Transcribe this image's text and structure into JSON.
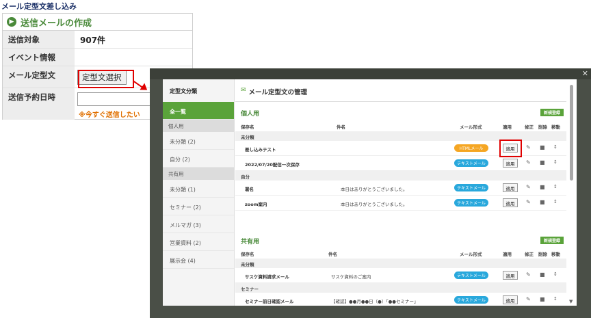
{
  "page_title": "メール定型文差し込み",
  "form": {
    "heading": "送信メールの作成",
    "rows": [
      {
        "label": "送信対象",
        "value": "907件"
      },
      {
        "label": "イベント情報",
        "value": ""
      },
      {
        "label": "メール定型文",
        "button": "定型文選択"
      },
      {
        "label": "送信予約日時",
        "note": "※今すぐ送信したい"
      }
    ]
  },
  "modal": {
    "sidebar_title": "定型文分類",
    "sidebar_items": [
      {
        "label": "全一覧",
        "active": true
      },
      {
        "group": "個人用"
      },
      {
        "label": "未分類 (2)"
      },
      {
        "label": "自分 (2)"
      },
      {
        "group": "共有用"
      },
      {
        "label": "未分類 (1)"
      },
      {
        "label": "セミナー (2)"
      },
      {
        "label": "メルマガ (3)"
      },
      {
        "label": "営業資料 (2)"
      },
      {
        "label": "展示会 (4)"
      }
    ],
    "title": "メール定型文の管理",
    "columns": {
      "name": "保存名",
      "subject": "件名",
      "format": "メール形式",
      "apply": "適用",
      "edit": "修正",
      "delete": "削除",
      "move": "移動"
    },
    "new_button": "新規登録",
    "sections": [
      {
        "title": "個人用",
        "groups": [
          {
            "name": "未分類",
            "rows": [
              {
                "name": "差し込みテスト",
                "subject": "",
                "format": "HTMLメール",
                "apply": "適用"
              },
              {
                "name": "2022/07/20配信一次保存",
                "subject": "",
                "format": "テキストメール",
                "apply": "適用"
              }
            ]
          },
          {
            "name": "自分",
            "rows": [
              {
                "name": "署名",
                "subject": "本日はありがとうございました。",
                "format": "テキストメール",
                "apply": "適用"
              },
              {
                "name": "zoom案内",
                "subject": "本日はありがとうございました。",
                "format": "テキストメール",
                "apply": "適用"
              }
            ]
          }
        ]
      },
      {
        "title": "共有用",
        "groups": [
          {
            "name": "未分類",
            "rows": [
              {
                "name": "サスケ資料請求メール",
                "subject": "サスケ資料のご案内",
                "format": "テキストメール",
                "apply": "適用"
              }
            ]
          },
          {
            "name": "セミナー",
            "rows": [
              {
                "name": "セミナー前日確認メール",
                "subject": "【確認】●●月●●日（●）「●●セミナー」",
                "format": "テキストメール",
                "apply": "適用"
              }
            ]
          }
        ]
      }
    ]
  }
}
